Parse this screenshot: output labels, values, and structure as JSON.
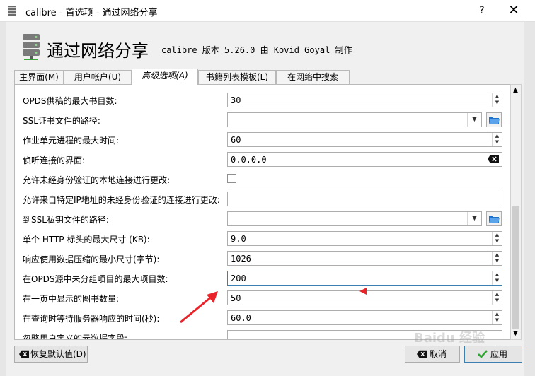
{
  "window": {
    "title": "calibre - 首选项 - 通过网络分享",
    "help_label": "?",
    "close_label": "✕"
  },
  "header": {
    "title": "通过网络分享",
    "subtitle": "calibre 版本 5.26.0 由 Kovid Goyal 制作"
  },
  "tabs": [
    {
      "label": "主界面(M)",
      "active": false
    },
    {
      "label": "用户帐户(U)",
      "active": false
    },
    {
      "label": "高级选项(A)",
      "active": true
    },
    {
      "label": "书籍列表模板(L)",
      "active": false
    },
    {
      "label": "在网络中搜索",
      "active": false
    }
  ],
  "settings": [
    {
      "label": "OPDS供稿的最大书目数:",
      "value": "30",
      "control": "spin"
    },
    {
      "label": "SSL证书文件的路径:",
      "value": "",
      "control": "path"
    },
    {
      "label": "作业单元进程的最大时间:",
      "value": "60",
      "control": "spin"
    },
    {
      "label": "侦听连接的界面:",
      "value": "0.0.0.0",
      "control": "clearable"
    },
    {
      "label": "允许未经身份验证的本地连接进行更改:",
      "value": "",
      "control": "checkbox"
    },
    {
      "label": "允许来自特定IP地址的未经身份验证的连接进行更改:",
      "value": "",
      "control": "text"
    },
    {
      "label": "到SSL私钥文件的路径:",
      "value": "",
      "control": "path"
    },
    {
      "label": "单个 HTTP 标头的最大尺寸 (KB):",
      "value": "9.0",
      "control": "spin"
    },
    {
      "label": "响应使用数据压缩的最小尺寸(字节):",
      "value": "1026",
      "control": "spin"
    },
    {
      "label": "在OPDS源中未分组项目的最大项目数:",
      "value": "200",
      "control": "spin"
    },
    {
      "label": "在一页中显示的图书数量:",
      "value": "50",
      "control": "spin"
    },
    {
      "label": "在查询时等待服务器响应的时间(秒):",
      "value": "60.0",
      "control": "spin"
    },
    {
      "label": "忽略用户定义的元数据字段:",
      "value": "",
      "control": "text"
    }
  ],
  "buttons": {
    "restore_defaults": "恢复默认值(D)",
    "cancel": "取消",
    "apply": "应用"
  },
  "watermark": "Baidu 经验",
  "colors": {
    "annotation_red": "#e8232a",
    "apply_check_green": "#2fa52f",
    "folder_blue": "#1e6fc9"
  }
}
